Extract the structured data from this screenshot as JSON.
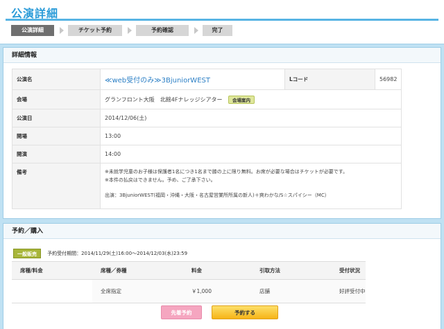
{
  "page": {
    "title": "公演詳細"
  },
  "steps": [
    {
      "label": "公演詳細",
      "active": true
    },
    {
      "label": "チケット予約",
      "active": false
    },
    {
      "label": "予約確認",
      "active": false
    },
    {
      "label": "完了",
      "active": false
    }
  ],
  "details": {
    "heading": "詳細情報",
    "event_name_label": "公演名",
    "event_name": "≪web受付のみ≫3BjuniorWEST",
    "lcode_label": "Lコード",
    "lcode": "56982",
    "venue_label": "会場",
    "venue": "グランフロント大阪　北館4Fナレッジシアター",
    "venue_guide_button": "会場案内",
    "date_label": "公演日",
    "date": "2014/12/06(土)",
    "open_label": "開場",
    "open": "13:00",
    "start_label": "開演",
    "start": "14:00",
    "notes_label": "備考",
    "notes_line1": "※未就学児童のお子様は保護者1名につき1名まで膝の上に限り無料。お席が必要な場合はチケットが必要です。",
    "notes_line2": "※本件の払戻はできません。予め、ご了承下さい。",
    "notes_cast": "出演：3BjuniorWEST(福岡・沖縄・大阪・名古屋営業所所属の新人)＋爽わかな/S☆スパイシー（MC）"
  },
  "reservation": {
    "heading": "予約／購入",
    "sale_badge": "一般販売",
    "sale_period": "予約受付期間：2014/11/29(土)16:00～2014/12/03(水)23:59",
    "columns": [
      "席種/料金",
      "席種／券種",
      "料金",
      "引取方法",
      "受付状況"
    ],
    "row": {
      "seat": "全席指定",
      "price": "￥1,000",
      "pickup": "店舗",
      "status": "好評受付中"
    },
    "presale_button": "先着予約",
    "reserve_button": "予約する"
  },
  "colors": {
    "title": "#2a9bd8",
    "background": "#bfe1f3",
    "sale_badge": "#a8b63a",
    "reserve_button": "#f6b418",
    "presale_button": "#f5a6c0"
  }
}
